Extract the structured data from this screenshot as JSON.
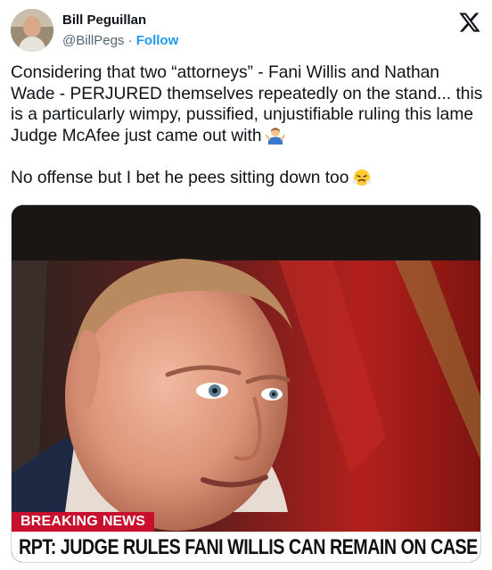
{
  "author": {
    "display_name": "Bill Peguillan",
    "handle": "@BillPegs",
    "separator": "·",
    "follow_label": "Follow"
  },
  "tweet": {
    "paragraph_1": "Considering that two “attorneys” - Fani Willis and Nathan Wade - PERJURED themselves repeatedly on the stand... this is a particularly wimpy, pussified, unjustifiable ruling this lame Judge McAfee just came out with",
    "emoji_1": "man-shrugging-emoji",
    "paragraph_2": "No offense but I bet he pees sitting down too",
    "emoji_2": "face-with-steam-emoji"
  },
  "media": {
    "breaking_word_1": "BREAKING",
    "breaking_word_2": "NEWS",
    "headline": "RPT: JUDGE RULES FANI WILLIS CAN REMAIN ON CASE"
  },
  "icons": {
    "logo": "x-logo-icon"
  },
  "colors": {
    "follow": "#1d9bf0",
    "handle": "#536471",
    "text": "#0f1419",
    "breaking_red": "#c8102e"
  }
}
